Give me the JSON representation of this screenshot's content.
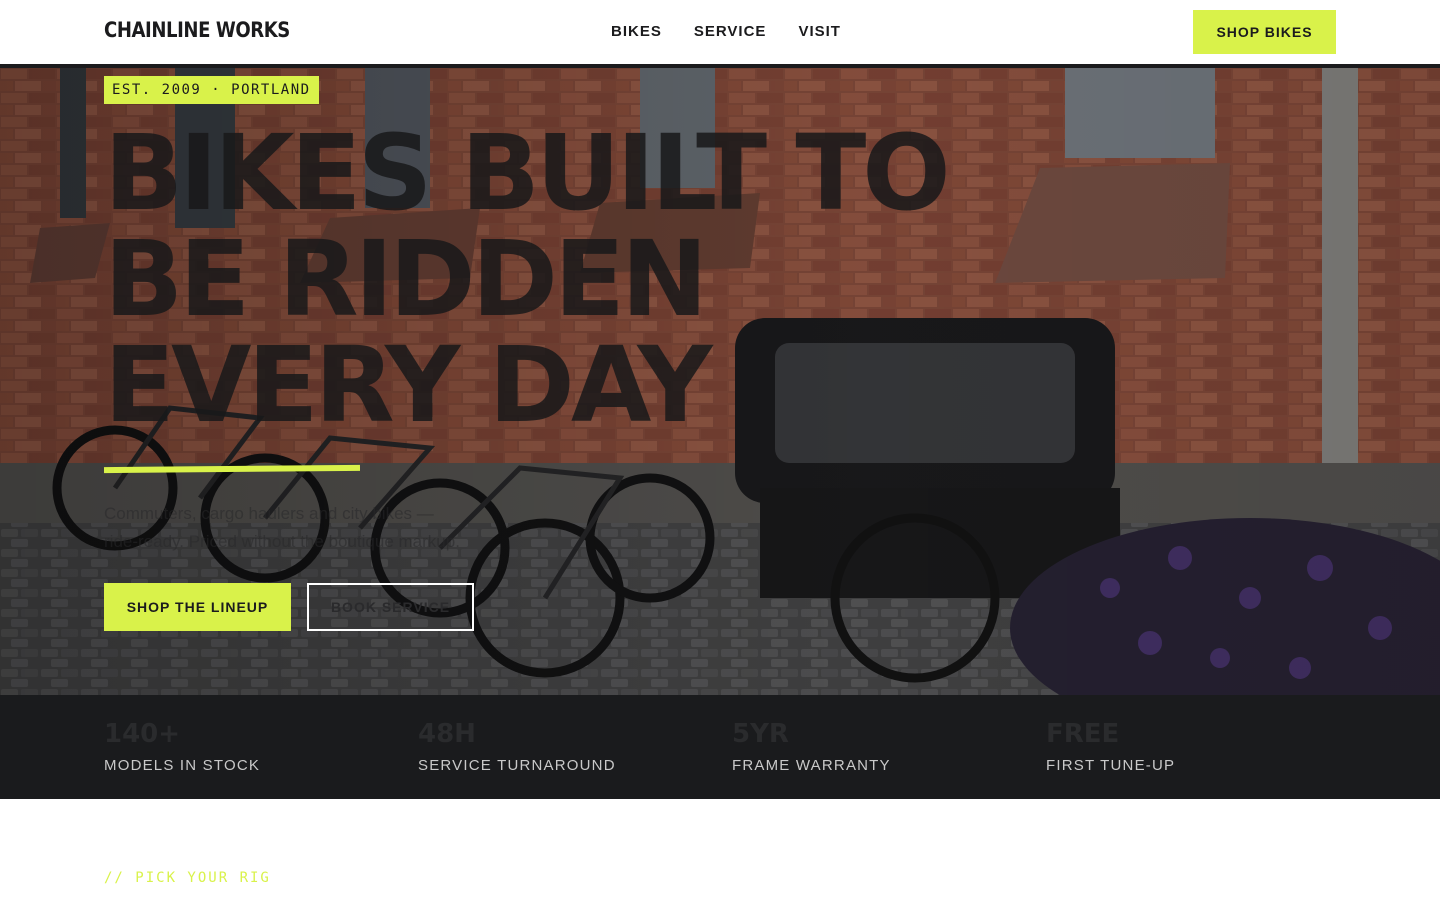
{
  "nav": {
    "logo": "CHAINLINE WORKS",
    "links": [
      "BIKES",
      "SERVICE",
      "VISIT"
    ],
    "cta": "SHOP BIKES"
  },
  "hero": {
    "badge": "EST. 2009 · PORTLAND",
    "headline_lines": [
      "BIKES BUILT TO",
      "BE RIDDEN",
      "EVERY DAY"
    ],
    "subtext": "Commuters, cargo haulers and city bikes — ride-ready. Priced without the boutique markup.",
    "primary_cta": "SHOP THE LINEUP",
    "secondary_cta": "BOOK SERVICE"
  },
  "stats": [
    {
      "value": "140+",
      "label": "MODELS IN STOCK"
    },
    {
      "value": "48H",
      "label": "SERVICE TURNAROUND"
    },
    {
      "value": "5YR",
      "label": "FRAME WARRANTY"
    },
    {
      "value": "FREE",
      "label": "FIRST TUNE-UP"
    }
  ],
  "section": {
    "eyebrow": "// PICK YOUR RIG"
  },
  "colors": {
    "accent": "#d9f24a",
    "ink": "#1b1b1d",
    "dark_band": "#1a1b1d"
  }
}
